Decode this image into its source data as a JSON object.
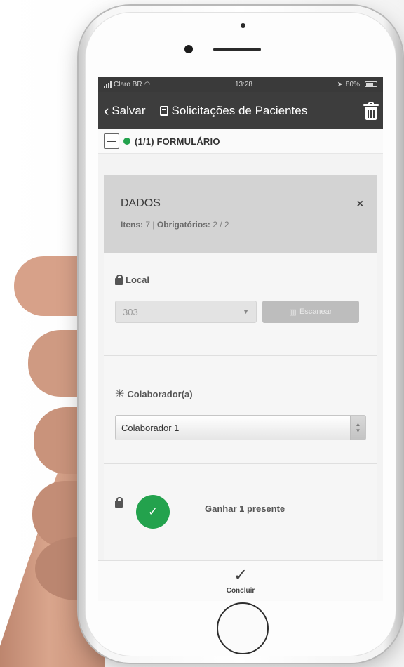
{
  "status_bar": {
    "carrier": "Claro BR",
    "time": "13:28",
    "battery": "80%"
  },
  "navbar": {
    "back_label": "Salvar",
    "title": "Solicitações de Pacientes"
  },
  "form_header": {
    "title": "(1/1) FORMULÁRIO"
  },
  "dados": {
    "title": "DADOS",
    "itens_label": "Itens:",
    "itens_value": "7",
    "separator": "|",
    "obrig_label": "Obrigatórios:",
    "obrig_value": "2 / 2",
    "close": "×"
  },
  "local": {
    "label": "Local",
    "value": "303",
    "scan_label": "Escanear"
  },
  "colaborador": {
    "required_mark": "✳",
    "label": "Colaborador(a)",
    "value": "Colaborador 1"
  },
  "gift": {
    "text": "Ganhar 1 presente"
  },
  "footer": {
    "action_label": "Concluir"
  },
  "colors": {
    "green": "#23a24d",
    "navbar": "#3d3d3d"
  }
}
